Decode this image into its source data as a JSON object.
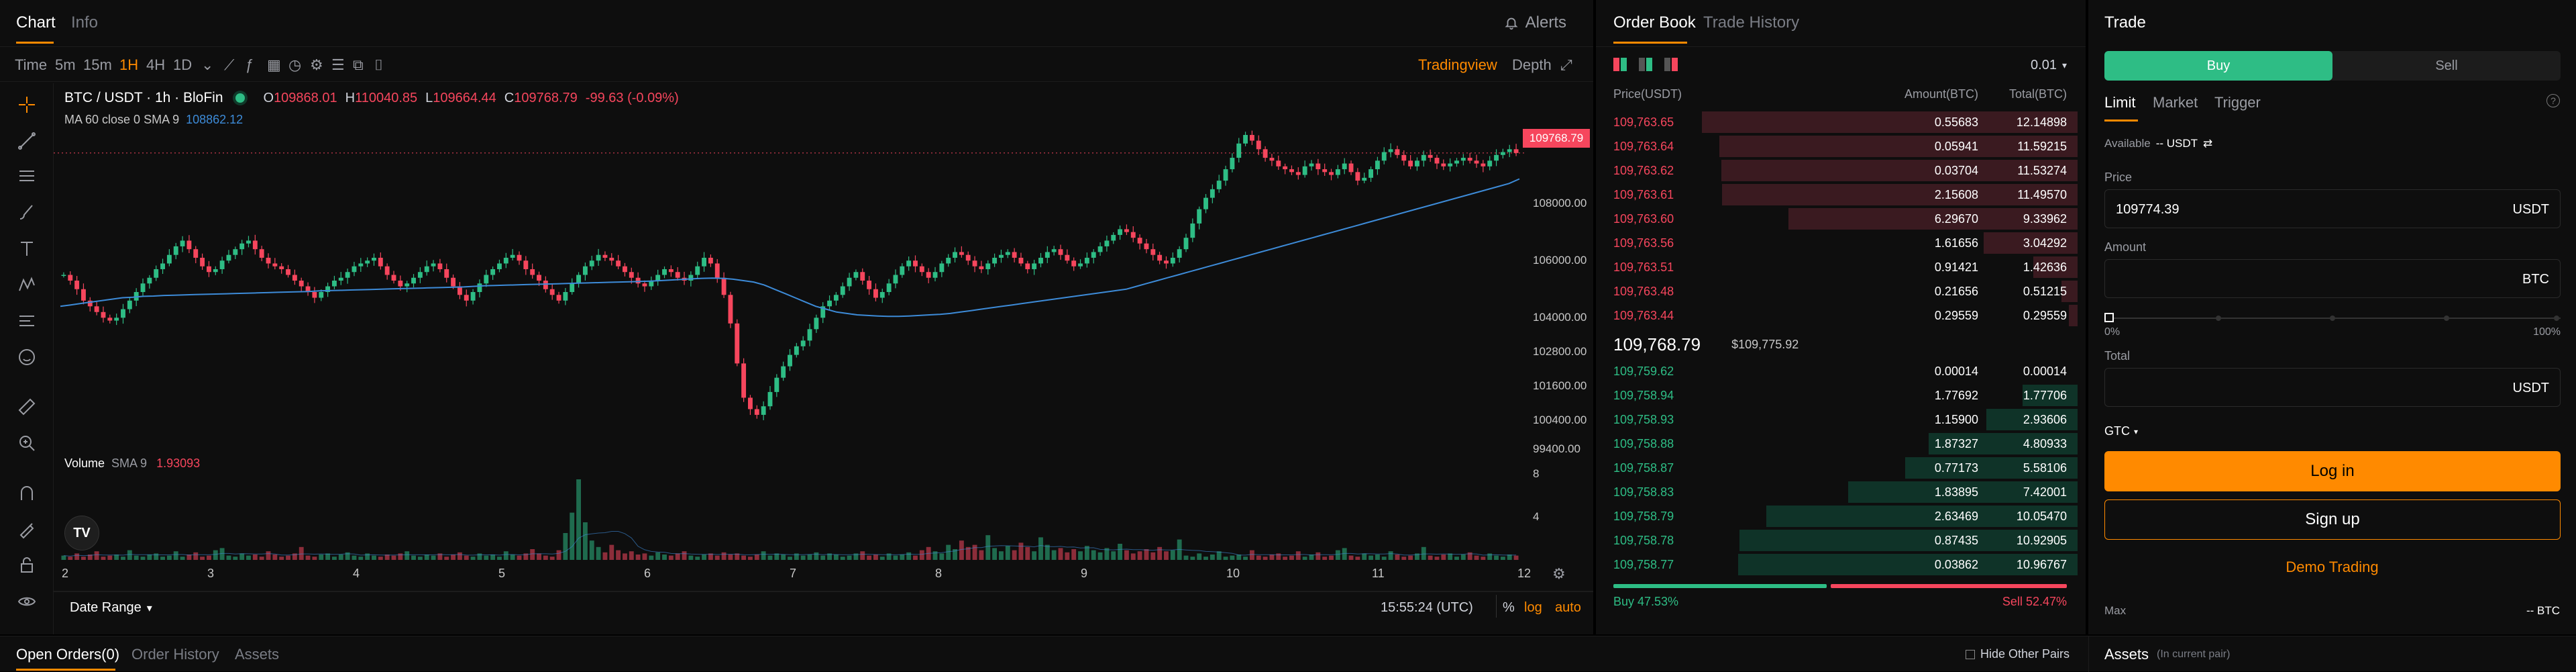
{
  "chart_panel": {
    "tabs": [
      "Chart",
      "Info"
    ],
    "alerts_label": "Alerts",
    "toolbar": {
      "time_label": "Time",
      "intervals": [
        "5m",
        "15m",
        "1H",
        "4H",
        "1D"
      ],
      "active_interval": "1H",
      "tradingview_label": "Tradingview",
      "depth_label": "Depth"
    },
    "symbol_title": "BTC / USDT · 1h · BloFin",
    "ohlc": {
      "o_label": "O",
      "o": "109868.01",
      "h_label": "H",
      "h": "110040.85",
      "l_label": "L",
      "l": "109664.44",
      "c_label": "C",
      "c": "109768.79",
      "change": "-99.63 (-0.09%)"
    },
    "ma_legend": {
      "label": "MA 60 close 0 SMA 9",
      "value": "108862.12"
    },
    "current_price_label": "109768.79",
    "price_ticks": [
      "108000.00",
      "106000.00",
      "104000.00",
      "102800.00",
      "101600.00",
      "100400.00",
      "99400.00"
    ],
    "volume_legend": {
      "label": "Volume",
      "sma": "SMA 9",
      "value": "1.93093"
    },
    "volume_ticks": [
      "8",
      "4"
    ],
    "date_ticks": [
      "2",
      "3",
      "4",
      "5",
      "6",
      "7",
      "8",
      "9",
      "10",
      "11",
      "12"
    ],
    "date_range_label": "Date Range",
    "clock": "15:55:24 (UTC)",
    "scale_opts": [
      "%",
      "log",
      "auto"
    ],
    "colors": {
      "up": "#2ebd85",
      "down": "#f6465d",
      "ma": "#3d8bd8",
      "accent": "#ff8a00"
    }
  },
  "chart_data": {
    "type": "candlestick",
    "title": "BTC / USDT · 1h · BloFin",
    "xlabel": "",
    "ylabel": "",
    "x_ticks": [
      "2",
      "3",
      "4",
      "5",
      "6",
      "7",
      "8",
      "9",
      "10",
      "11",
      "12"
    ],
    "ylim": [
      99400,
      110800
    ],
    "price_path": [
      105500,
      105300,
      105000,
      104600,
      104400,
      104200,
      104000,
      103900,
      104000,
      104300,
      104600,
      104900,
      105200,
      105400,
      105700,
      105900,
      106200,
      106500,
      106700,
      106400,
      106100,
      105800,
      105600,
      105700,
      106000,
      106200,
      106400,
      106600,
      106700,
      106400,
      106100,
      105900,
      105800,
      105700,
      105500,
      105300,
      105100,
      104900,
      104700,
      104900,
      105100,
      105300,
      105400,
      105600,
      105800,
      105900,
      106000,
      106100,
      105800,
      105500,
      105300,
      105100,
      105200,
      105400,
      105600,
      105800,
      105900,
      105700,
      105400,
      105100,
      104800,
      104600,
      104900,
      105200,
      105500,
      105700,
      105900,
      106100,
      106200,
      106000,
      105700,
      105500,
      105300,
      105000,
      104800,
      104600,
      104900,
      105200,
      105500,
      105800,
      106000,
      106200,
      106100,
      106000,
      105800,
      105600,
      105400,
      105200,
      105100,
      105300,
      105500,
      105700,
      105600,
      105400,
      105300,
      105500,
      105800,
      106100,
      105900,
      105400,
      104800,
      103800,
      102400,
      101200,
      100800,
      100600,
      100900,
      101400,
      101900,
      102300,
      102700,
      103000,
      103200,
      103600,
      104000,
      104400,
      104600,
      104800,
      105100,
      105400,
      105600,
      105300,
      105000,
      104700,
      104900,
      105200,
      105500,
      105800,
      106000,
      105800,
      105600,
      105400,
      105600,
      105900,
      106100,
      106300,
      106200,
      106000,
      105800,
      105700,
      105900,
      106100,
      106200,
      106300,
      106100,
      105900,
      105700,
      105900,
      106100,
      106300,
      106400,
      106200,
      106000,
      105800,
      105900,
      106100,
      106300,
      106500,
      106700,
      106900,
      107100,
      107000,
      106800,
      106600,
      106400,
      106200,
      106000,
      105900,
      106100,
      106400,
      106800,
      107300,
      107800,
      108200,
      108500,
      108800,
      109200,
      109600,
      110100,
      110400,
      110200,
      109900,
      109600,
      109500,
      109300,
      109200,
      109100,
      109000,
      109300,
      109400,
      109200,
      109100,
      109000,
      109200,
      109400,
      109100,
      108800,
      108900,
      109200,
      109500,
      109800,
      109900,
      109700,
      109500,
      109300,
      109500,
      109700,
      109600,
      109400,
      109300,
      109400,
      109500,
      109600,
      109500,
      109400,
      109300,
      109500,
      109700,
      109800,
      109900,
      109768
    ],
    "ma_path": [
      104400,
      104450,
      104500,
      104550,
      104600,
      104650,
      104700,
      104720,
      104750,
      104760,
      104780,
      104790,
      104800,
      104810,
      104820,
      104830,
      104840,
      104850,
      104860,
      104870,
      104880,
      104890,
      104900,
      104910,
      104920,
      104940,
      104950,
      104960,
      104970,
      104980,
      104990,
      105000,
      105010,
      105020,
      105030,
      105040,
      105050,
      105060,
      105070,
      105080,
      105100,
      105120,
      105130,
      105140,
      105150,
      105160,
      105170,
      105180,
      105190,
      105200,
      105210,
      105220,
      105230,
      105240,
      105250,
      105260,
      105270,
      105280,
      105300,
      105320,
      105340,
      105360,
      105380,
      105390,
      105380,
      105350,
      105300,
      105250,
      105150,
      105000,
      104850,
      104700,
      104550,
      104400,
      104300,
      104200,
      104150,
      104100,
      104080,
      104060,
      104050,
      104050,
      104060,
      104080,
      104100,
      104120,
      104150,
      104200,
      104250,
      104300,
      104350,
      104400,
      104450,
      104500,
      104550,
      104600,
      104650,
      104700,
      104750,
      104800,
      104850,
      104900,
      104950,
      105000,
      105100,
      105200,
      105300,
      105400,
      105500,
      105600,
      105700,
      105800,
      105900,
      106000,
      106100,
      106200,
      106300,
      106400,
      106500,
      106600,
      106700,
      106800,
      106900,
      107000,
      107100,
      107200,
      107300,
      107400,
      107500,
      107600,
      107700,
      107800,
      107900,
      108000,
      108100,
      108200,
      108300,
      108400,
      108500,
      108600,
      108700,
      108862
    ],
    "volume_path": [
      0.4,
      0.3,
      0.6,
      0.3,
      0.5,
      0.8,
      0.3,
      0.4,
      0.5,
      0.3,
      0.9,
      0.4,
      0.3,
      0.5,
      0.6,
      0.3,
      0.4,
      0.8,
      0.3,
      0.5,
      0.7,
      0.3,
      0.4,
      0.9,
      1.1,
      0.4,
      0.3,
      0.6,
      0.4,
      0.5,
      0.3,
      0.8,
      0.5,
      0.3,
      0.4,
      0.6,
      1.2,
      0.4,
      0.3,
      0.5,
      0.6,
      0.3,
      0.5,
      0.7,
      0.4,
      0.3,
      0.6,
      0.4,
      0.3,
      0.5,
      0.4,
      0.6,
      0.8,
      0.4,
      0.3,
      0.5,
      0.4,
      0.6,
      0.3,
      0.5,
      0.7,
      0.4,
      0.3,
      0.6,
      0.4,
      0.5,
      0.3,
      0.8,
      0.5,
      0.4,
      0.6,
      1.0,
      0.6,
      0.4,
      0.3,
      0.9,
      2.5,
      4.4,
      7.5,
      3.5,
      1.8,
      1.2,
      0.7,
      1.4,
      0.9,
      0.6,
      0.8,
      0.5,
      0.6,
      0.4,
      0.7,
      0.5,
      0.4,
      0.6,
      0.8,
      0.4,
      0.3,
      0.5,
      0.6,
      0.4,
      0.7,
      0.5,
      0.6,
      0.4,
      0.3,
      0.5,
      0.8,
      0.4,
      0.6,
      0.5,
      0.3,
      0.6,
      0.4,
      0.5,
      0.7,
      0.4,
      0.6,
      0.5,
      0.3,
      0.4,
      0.6,
      0.8,
      0.4,
      0.5,
      0.3,
      0.6,
      0.4,
      0.5,
      0.7,
      0.4,
      0.9,
      1.2,
      0.8,
      0.6,
      1.4,
      1.0,
      1.8,
      1.2,
      1.4,
      0.9,
      2.3,
      1.1,
      0.8,
      1.3,
      0.9,
      1.6,
      1.2,
      0.8,
      2.1,
      1.4,
      0.9,
      1.1,
      0.7,
      1.0,
      0.8,
      1.3,
      0.9,
      0.7,
      1.1,
      0.8,
      1.5,
      0.9,
      0.6,
      0.8,
      1.0,
      0.7,
      1.2,
      0.8,
      0.9,
      1.9
    ]
  },
  "orderbook": {
    "tabs": [
      "Order Book",
      "Trade History"
    ],
    "precision": "0.01",
    "headers": [
      "Price(USDT)",
      "Amount(BTC)",
      "Total(BTC)"
    ],
    "asks": [
      {
        "price": "109,763.65",
        "amount": "0.55683",
        "total": "12.14898",
        "depth": 1.0
      },
      {
        "price": "109,763.64",
        "amount": "0.05941",
        "total": "11.59215",
        "depth": 0.954
      },
      {
        "price": "109,763.62",
        "amount": "0.03704",
        "total": "11.53274",
        "depth": 0.949
      },
      {
        "price": "109,763.61",
        "amount": "2.15608",
        "total": "11.49570",
        "depth": 0.946
      },
      {
        "price": "109,763.60",
        "amount": "6.29670",
        "total": "9.33962",
        "depth": 0.769
      },
      {
        "price": "109,763.56",
        "amount": "1.61656",
        "total": "3.04292",
        "depth": 0.25
      },
      {
        "price": "109,763.51",
        "amount": "0.91421",
        "total": "1.42636",
        "depth": 0.117
      },
      {
        "price": "109,763.48",
        "amount": "0.21656",
        "total": "0.51215",
        "depth": 0.042
      },
      {
        "price": "109,763.44",
        "amount": "0.29559",
        "total": "0.29559",
        "depth": 0.024
      }
    ],
    "last_price": "109,768.79",
    "mark_price": "$109,775.92",
    "bids": [
      {
        "price": "109,759.62",
        "amount": "0.00014",
        "total": "0.00014",
        "depth": 0.0
      },
      {
        "price": "109,758.94",
        "amount": "1.77692",
        "total": "1.77706",
        "depth": 0.146
      },
      {
        "price": "109,758.93",
        "amount": "1.15900",
        "total": "2.93606",
        "depth": 0.242
      },
      {
        "price": "109,758.88",
        "amount": "1.87327",
        "total": "4.80933",
        "depth": 0.396
      },
      {
        "price": "109,758.87",
        "amount": "0.77173",
        "total": "5.58106",
        "depth": 0.459
      },
      {
        "price": "109,758.83",
        "amount": "1.83895",
        "total": "7.42001",
        "depth": 0.611
      },
      {
        "price": "109,758.79",
        "amount": "2.63469",
        "total": "10.05470",
        "depth": 0.828
      },
      {
        "price": "109,758.78",
        "amount": "0.87435",
        "total": "10.92905",
        "depth": 0.9
      },
      {
        "price": "109,758.77",
        "amount": "0.03862",
        "total": "10.96767",
        "depth": 0.903
      }
    ],
    "buy_ratio_label": "Buy 47.53%",
    "sell_ratio_label": "Sell 52.47%",
    "buy_ratio": 0.4753
  },
  "trade": {
    "title": "Trade",
    "side_buy": "Buy",
    "side_sell": "Sell",
    "order_types": [
      "Limit",
      "Market",
      "Trigger"
    ],
    "available_label": "Available",
    "available_value": "-- USDT",
    "price_label": "Price",
    "price_value": "109774.39",
    "price_unit": "USDT",
    "amount_label": "Amount",
    "amount_unit": "BTC",
    "slider_min": "0%",
    "slider_max": "100%",
    "slider_value": 0,
    "total_label": "Total",
    "total_unit": "USDT",
    "tif": "GTC",
    "login": "Log in",
    "signup": "Sign up",
    "demo": "Demo Trading",
    "max_label": "Max",
    "max_value": "-- BTC",
    "assets_label": "Assets",
    "assets_note": "(In current pair)"
  },
  "bottom": {
    "tabs": [
      "Open Orders(0)",
      "Order History",
      "Assets"
    ],
    "hide_pairs": "Hide Other Pairs"
  }
}
